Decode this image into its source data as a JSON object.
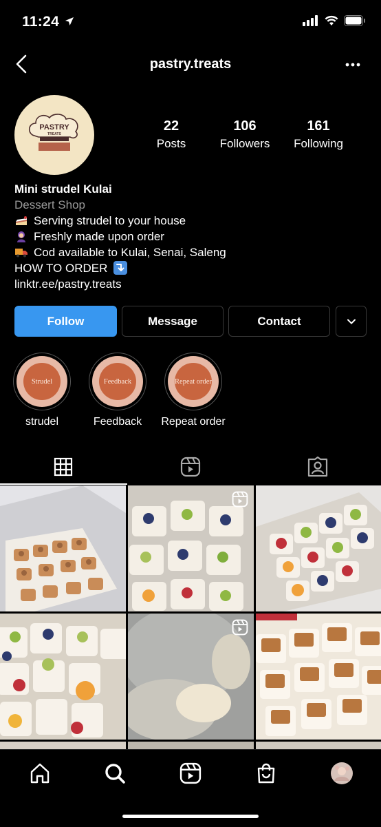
{
  "status": {
    "time": "11:24"
  },
  "header": {
    "username": "pastry.treats"
  },
  "profile": {
    "avatar_logo_text": "PASTRY",
    "avatar_logo_sub": "TREATS",
    "stats": [
      {
        "value": "22",
        "label": "Posts"
      },
      {
        "value": "106",
        "label": "Followers"
      },
      {
        "value": "161",
        "label": "Following"
      }
    ],
    "name": "Mini strudel Kulai",
    "category": "Dessert Shop",
    "bio_lines": [
      {
        "icon": "cake-emoji",
        "text": "Serving strudel to your house"
      },
      {
        "icon": "woman-cook-emoji",
        "text": "Freshly made upon order"
      },
      {
        "icon": "delivery-truck-emoji",
        "text": "Cod available to Kulai, Senai, Saleng"
      }
    ],
    "how_to_order": "HOW TO ORDER",
    "link": "linktr.ee/pastry.treats"
  },
  "actions": {
    "follow": "Follow",
    "message": "Message",
    "contact": "Contact"
  },
  "highlights": [
    {
      "cover": "Strudel",
      "label": "strudel"
    },
    {
      "cover": "Feedback",
      "label": "Feedback"
    },
    {
      "cover": "Repeat order",
      "label": "Repeat order"
    }
  ],
  "tabs": [
    "grid-icon",
    "reels-icon",
    "tagged-icon"
  ],
  "grid_posts": [
    {
      "type": "photo",
      "scene": "strudel-box"
    },
    {
      "type": "reel",
      "scene": "fruit-tarts"
    },
    {
      "type": "photo",
      "scene": "fruit-tray"
    },
    {
      "type": "photo",
      "scene": "fruit-closeup"
    },
    {
      "type": "reel",
      "scene": "blurred"
    },
    {
      "type": "photo",
      "scene": "biscoff"
    }
  ],
  "colors": {
    "accent": "#3897f0",
    "highlight_fill": "#c8653f",
    "background": "#000000"
  }
}
